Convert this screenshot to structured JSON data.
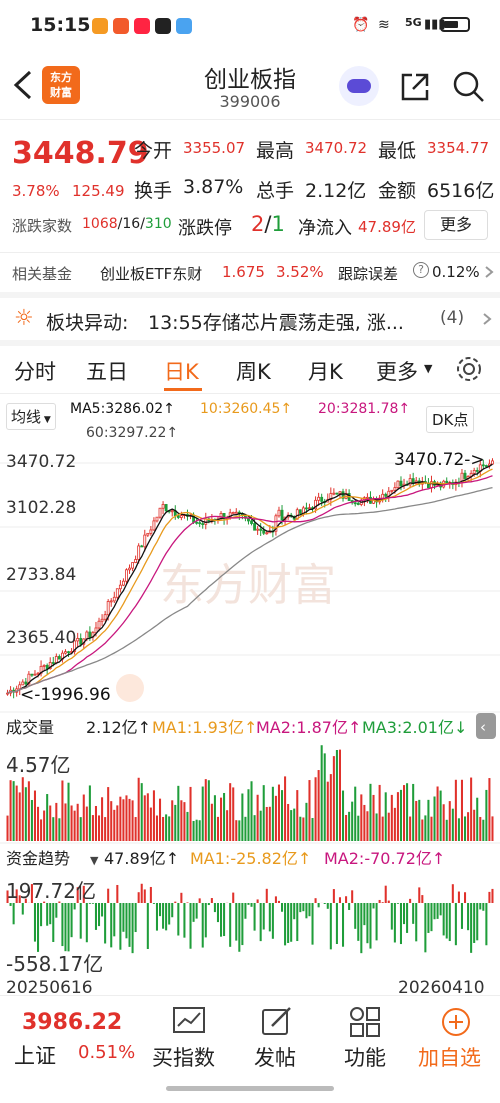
{
  "status_bar": {
    "time": "15:15",
    "icons": [
      "heart-app-icon",
      "red-app-icon",
      "xiaohongshu-icon",
      "notes-app-icon",
      "photo-app-icon"
    ],
    "right": "5G",
    "battery": "battery-icon"
  },
  "header": {
    "logo_line1": "东方",
    "logo_line2": "财富",
    "title": "创业板指",
    "code": "399006"
  },
  "quote": {
    "price": "3448.79",
    "change_pct": "3.78%",
    "change_abs": "125.49",
    "open_label": "今开",
    "open": "3355.07",
    "high_label": "最高",
    "high": "3470.72",
    "low_label": "最低",
    "low": "3354.77",
    "turnover_label": "换手",
    "turnover": "3.87%",
    "volume_label": "总手",
    "volume": "2.12亿",
    "amount_label": "金额",
    "amount": "6516亿",
    "breadth_label": "涨跌家数",
    "breadth_up": "1068",
    "breadth_flat": "16",
    "breadth_down": "310",
    "limit_label": "涨跌停",
    "limit_up": "2",
    "limit_down": "1",
    "inflow_label": "净流入",
    "inflow": "47.89亿",
    "more_label": "更多"
  },
  "fund": {
    "label": "相关基金",
    "name": "创业板ETF东财",
    "price": "1.675",
    "pct": "3.52%",
    "track_label": "跟踪误差",
    "track": "0.12%"
  },
  "alert": {
    "label": "板块异动:",
    "text": "13:55存储芯片震荡走强, 涨...",
    "count": "(4)"
  },
  "tabs": {
    "t1": "分时",
    "t2": "五日",
    "t3": "日K",
    "t4": "周K",
    "t5": "月K",
    "t6": "更多"
  },
  "indicators": {
    "ma_label": "均线",
    "ma5": "MA5:3286.02↑",
    "ma10": "10:3260.45↑",
    "ma20": "20:3281.78↑",
    "ma60": "60:3297.22↑",
    "dk": "DK点"
  },
  "kline_axis": {
    "y1": "3470.72",
    "y2": "3102.28",
    "y3": "2733.84",
    "y4": "2365.40",
    "max_mark": "3470.72->",
    "min_mark": "<-1996.96",
    "watermark": "东方财富"
  },
  "volume": {
    "label": "成交量",
    "value": "2.12亿↑",
    "ma1": "MA1:1.93亿↑",
    "ma2": "MA2:1.87亿↑",
    "ma3": "MA3:2.01亿↓",
    "axis": "4.57亿"
  },
  "fund_flow": {
    "label": "资金趋势",
    "value": "47.89亿↑",
    "ma1": "MA1:-25.82亿↑",
    "ma2": "MA2:-70.72亿↑",
    "axis_top": "197.72亿",
    "axis_bottom": "-558.17亿"
  },
  "dates": {
    "start": "20250616",
    "end": "20260410"
  },
  "bottom": {
    "index_price": "3986.22",
    "index_name": "上证",
    "index_pct": "0.51%",
    "b1": "买指数",
    "b2": "发帖",
    "b3": "功能",
    "b4": "加自选"
  },
  "colors": {
    "up": "#e0312b",
    "down": "#1f9d3a",
    "accent": "#f26a1b",
    "ma5": "#111111",
    "ma10": "#e89a1d",
    "ma20": "#c8177e",
    "ma60": "#888888"
  }
}
